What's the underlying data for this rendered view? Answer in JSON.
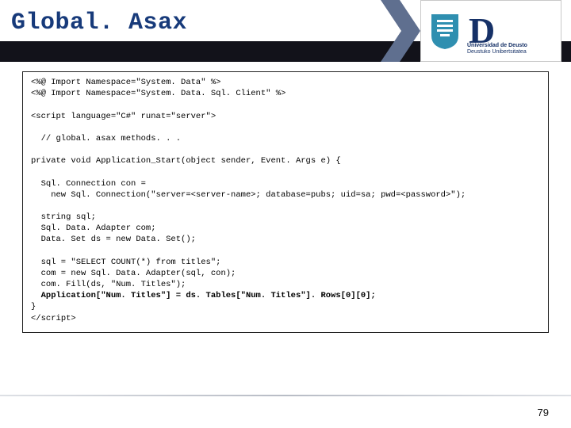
{
  "header": {
    "title": "Global. Asax"
  },
  "logo": {
    "uni_line1": "Universidad de Deusto",
    "uni_line2": "Deustuko Unibertsitatea",
    "shield_color": "#2f8fb0",
    "d_color": "#163167"
  },
  "code": {
    "l1": "<%@ Import Namespace=\"System. Data\" %>",
    "l2": "<%@ Import Namespace=\"System. Data. Sql. Client\" %>",
    "l3": "",
    "l4": "<script language=\"C#\" runat=\"server\">",
    "l5": "",
    "l6": "  // global. asax methods. . .",
    "l7": "",
    "l8": "private void Application_Start(object sender, Event. Args e) {",
    "l9": "",
    "l10": "  Sql. Connection con =",
    "l11": "    new Sql. Connection(\"server=<server-name>; database=pubs; uid=sa; pwd=<password>\");",
    "l12": "",
    "l13": "  string sql;",
    "l14": "  Sql. Data. Adapter com;",
    "l15": "  Data. Set ds = new Data. Set();",
    "l16": "",
    "l17": "  sql = \"SELECT COUNT(*) from titles\";",
    "l18": "  com = new Sql. Data. Adapter(sql, con);",
    "l19": "  com. Fill(ds, \"Num. Titles\");",
    "l20": "  Application[\"Num. Titles\"] = ds. Tables[\"Num. Titles\"]. Rows[0][0];",
    "l21": "}",
    "l22": "</scr",
    "l22b": "ipt>"
  },
  "footer": {
    "page": "79"
  }
}
